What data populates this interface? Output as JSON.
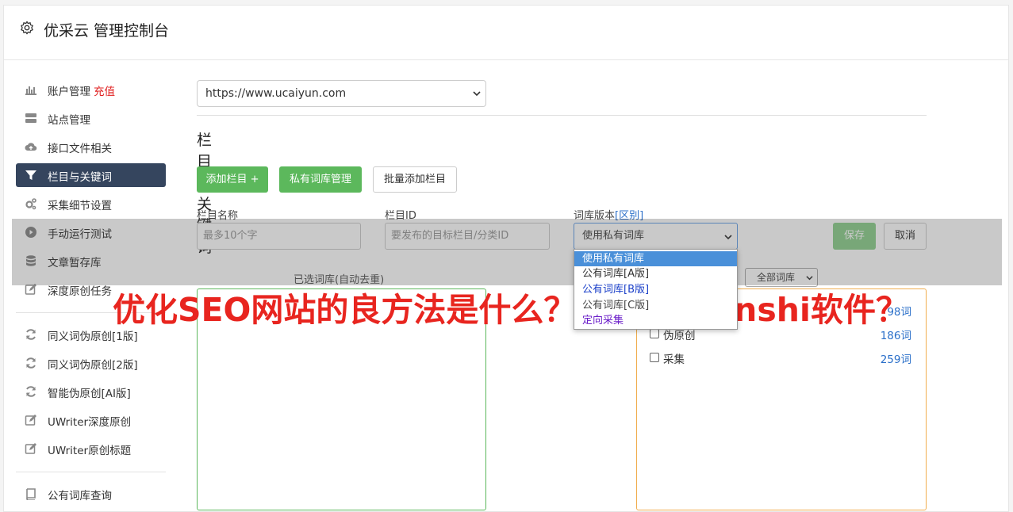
{
  "header": {
    "title": "优采云 管理控制台",
    "icon": "gear-icon"
  },
  "sidebar": {
    "items": [
      {
        "label": "账户管理",
        "badge": "充值",
        "icon": "bar-chart-icon"
      },
      {
        "label": "站点管理",
        "icon": "server-icon"
      },
      {
        "label": "接口文件相关",
        "icon": "cloud-upload-icon"
      },
      {
        "label": "栏目与关键词",
        "icon": "filter-icon",
        "active": true
      },
      {
        "label": "采集细节设置",
        "icon": "cogs-icon"
      },
      {
        "label": "手动运行测试",
        "icon": "play-circle-icon"
      },
      {
        "label": "文章暂存库",
        "icon": "database-icon"
      },
      {
        "label": "深度原创任务",
        "icon": "edit-icon"
      },
      {
        "label": "同义词伪原创[1版]",
        "icon": "refresh-icon"
      },
      {
        "label": "同义词伪原创[2版]",
        "icon": "refresh-icon"
      },
      {
        "label": "智能伪原创[AI版]",
        "icon": "refresh-icon"
      },
      {
        "label": "UWriter深度原创",
        "icon": "edit-icon"
      },
      {
        "label": "UWriter原创标题",
        "icon": "edit-icon"
      },
      {
        "label": "公有词库查询",
        "icon": "book-icon"
      }
    ]
  },
  "main": {
    "site_select": "https://www.ucaiyun.com",
    "section_title": "栏目与关键词",
    "buttons": {
      "add_column": "添加栏目 +",
      "private_dict": "私有词库管理",
      "batch_add": "批量添加栏目"
    },
    "form": {
      "name_label": "栏目名称",
      "name_placeholder": "最多10个字",
      "id_label": "栏目ID",
      "id_placeholder": "要发布的目标栏目/分类ID",
      "dict_label": "词库版本",
      "dict_link": "[区别]",
      "dict_value": "使用私有词库",
      "save": "保存",
      "cancel": "取消"
    },
    "dropdown_options": [
      "使用私有词库",
      "公有词库[A版]",
      "公有词库[B版]",
      "公有词库[C版]",
      "定向采集"
    ],
    "selected_label": "已选词库(自动去重)",
    "filter_select": "全部词库",
    "dict_list": [
      {
        "name": "",
        "count": "98词"
      },
      {
        "name": "伪原创",
        "count": "186词"
      },
      {
        "name": "采集",
        "count": "259词"
      }
    ]
  },
  "watermark": "优化SEO网站的良方法是什么？什么是Dianshi软件？"
}
